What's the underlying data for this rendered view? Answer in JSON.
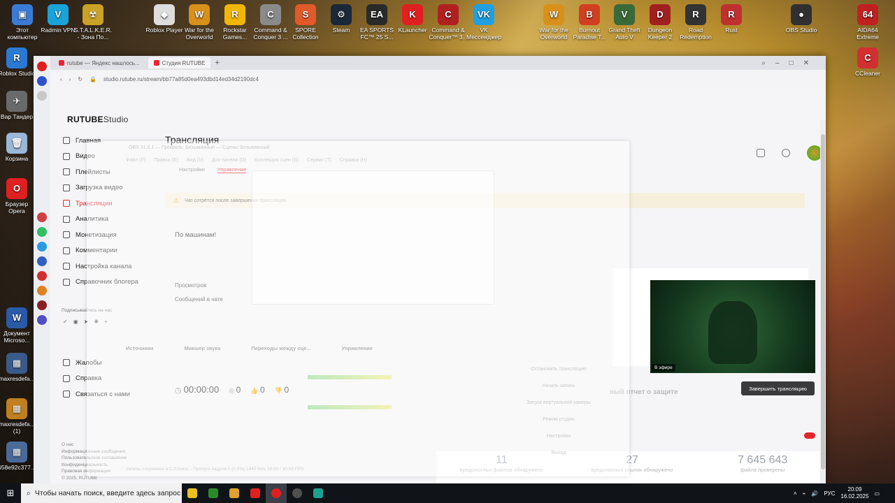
{
  "desktop": {
    "icons_top": [
      {
        "label": "Этот компьютер",
        "color": "#3a7bd5",
        "glyph": "▣"
      },
      {
        "label": "Radmin VPN",
        "color": "#1aa3d8",
        "glyph": "V"
      },
      {
        "label": "S.T.A.L.K.E.R. - Зона По...",
        "color": "#c9a227",
        "glyph": "☢"
      },
      {
        "label": "Roblox Player",
        "color": "#dddddd",
        "glyph": "◆"
      },
      {
        "label": "War for the Overworld",
        "color": "#d8901a",
        "glyph": "W"
      },
      {
        "label": "Rockstar Games...",
        "color": "#f2b705",
        "glyph": "R"
      },
      {
        "label": "Command & Conquer 3 ...",
        "color": "#8a8a8a",
        "glyph": "C"
      },
      {
        "label": "SPORE Collection",
        "color": "#e05a2a",
        "glyph": "S"
      },
      {
        "label": "Steam",
        "color": "#1b2838",
        "glyph": "⚙"
      },
      {
        "label": "EA SPORTS FC™ 25 S...",
        "color": "#2a2a2a",
        "glyph": "EA"
      },
      {
        "label": "KLauncher",
        "color": "#e02020",
        "glyph": "K"
      },
      {
        "label": "Command & Conquer™ 3...",
        "color": "#b02020",
        "glyph": "C"
      },
      {
        "label": "VK Мессенджер",
        "color": "#20a0e0",
        "glyph": "VK"
      },
      {
        "label": "War for the Overworld",
        "color": "#d8901a",
        "glyph": "W"
      },
      {
        "label": "Burnout Paradise T...",
        "color": "#d04020",
        "glyph": "B"
      },
      {
        "label": "Grand Theft Auto V",
        "color": "#3a6a3a",
        "glyph": "V"
      },
      {
        "label": "Dungeon Keeper 2",
        "color": "#a02020",
        "glyph": "D"
      },
      {
        "label": "Road Redemption",
        "color": "#333333",
        "glyph": "R"
      },
      {
        "label": "Rust",
        "color": "#c03030",
        "glyph": "R"
      },
      {
        "label": "OBS Studio",
        "color": "#303030",
        "glyph": "●"
      }
    ],
    "icons_left": [
      {
        "label": "Roblox Studio",
        "color": "#2a7ad5",
        "glyph": "R"
      },
      {
        "label": "Вар Тандер",
        "color": "#6a6a6a",
        "glyph": "✈"
      },
      {
        "label": "Корзина",
        "color": "#9ab8d8",
        "glyph": "🗑"
      },
      {
        "label": "Браузер Opera",
        "color": "#e02020",
        "glyph": "O"
      },
      {
        "label": "Документ Microso...",
        "color": "#2a5aa8",
        "glyph": "W"
      },
      {
        "label": "maxresdefa...",
        "color": "#3a5a8a",
        "glyph": "▦"
      },
      {
        "label": "maxresdefa... (1)",
        "color": "#c08020",
        "glyph": "▦"
      },
      {
        "label": "658e92c377...",
        "color": "#4a6a9a",
        "glyph": "▦"
      }
    ],
    "icons_right": [
      {
        "label": "AIDA64 Extreme",
        "color": "#c02020",
        "glyph": "64"
      },
      {
        "label": "CCleaner",
        "color": "#d03030",
        "glyph": "C"
      }
    ]
  },
  "browser": {
    "tabs": [
      {
        "label": "rutube — Яндекс нашлось..."
      },
      {
        "label": "Студия RUTUBE"
      }
    ],
    "url": "studio.rutube.ru/stream/bb77a85d0ea493dbd14ed34d2190dc4"
  },
  "studio": {
    "logo": "RUTUBE",
    "logo_suffix": "Studio",
    "nav": [
      {
        "label": "Главная",
        "active": false
      },
      {
        "label": "Видео",
        "active": false
      },
      {
        "label": "Плейлисты",
        "active": false
      },
      {
        "label": "Загрузка видео",
        "active": false
      },
      {
        "label": "Трансляции",
        "active": true
      },
      {
        "label": "Аналитика",
        "active": false
      },
      {
        "label": "Монетизация",
        "active": false
      },
      {
        "label": "Комментарии",
        "active": false
      },
      {
        "label": "Настройка канала",
        "active": false
      },
      {
        "label": "Справочник блогера",
        "active": false
      }
    ],
    "nav_bottom": [
      {
        "label": "Жалобы"
      },
      {
        "label": "Справка"
      },
      {
        "label": "Связаться с нами"
      }
    ],
    "subscribe_label": "Подписывайтесь на нас",
    "footer": [
      "О нас",
      "Информационные сообщения",
      "Пользовательское соглашение",
      "Конфиденциальность",
      "Правовая информация",
      "© 2025, RUTUBE"
    ],
    "page_title": "Трансляция",
    "tabs": [
      "Настройки",
      "Управление"
    ],
    "notice": "Чат сотрётся после завершения трансляции",
    "stream_name": "По машинам!",
    "views_label": "Просмотров",
    "chat_label": "Сообщений в чате",
    "timer": "00:00:00",
    "viewers": "0",
    "likes": "0",
    "dislikes": "0",
    "live_badge": "В эфире",
    "end_button": "Завершить трансляцию",
    "defense_title": "ный отчет о защите",
    "counters": [
      {
        "value": "11",
        "label": "вредоносных файлов обнаружено"
      },
      {
        "value": "27",
        "label": "вредоносных ссылок обнаружено"
      },
      {
        "value": "7 645 643",
        "label": "файла проверены"
      }
    ]
  },
  "obs": {
    "title": "OBS 31.0.1 — Профиль: Безымянный — Сцены: Безымянный",
    "menu": [
      "Файл (F)",
      "Правка (E)",
      "Вид (V)",
      "Док-панели (D)",
      "Коллекция сцен (S)",
      "Сервис (T)",
      "Справка (H)"
    ],
    "docks": [
      "Источники",
      "Микшер звука",
      "Переходы между сце...",
      "Управление"
    ],
    "controls": [
      "Остановить трансляцию",
      "Начать запись",
      "Запуск виртуальной камеры",
      "Режим студии",
      "Настройки",
      "Выход"
    ],
    "status": "Запись сохранена в C:/Users/... Пропуск кадров 0 (0.0%) 1445 kb/s 30.00 / 30.00 FPS"
  },
  "taskbar": {
    "search_placeholder": "Чтобы начать поиск, введите здесь запрос",
    "language": "РУС",
    "time": "20:09",
    "date": "16.02.2025"
  }
}
